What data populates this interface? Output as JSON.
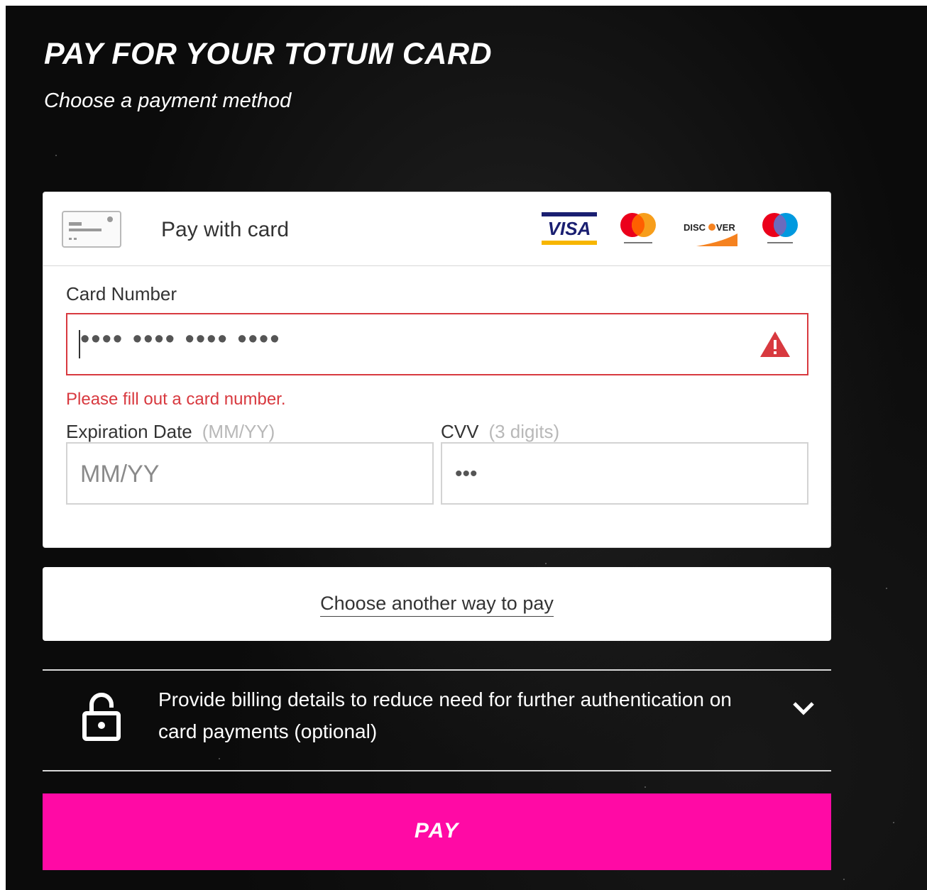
{
  "header": {
    "title": "PAY FOR YOUR TOTUM CARD",
    "subtitle": "Choose a payment method"
  },
  "card_panel": {
    "header_label": "Pay with card",
    "card_icon": "credit-card-icon",
    "brands": [
      {
        "name": "visa-logo",
        "text": "VISA"
      },
      {
        "name": "mastercard-logo",
        "text": "mastercard"
      },
      {
        "name": "discover-logo",
        "text": "DISCOVER"
      },
      {
        "name": "maestro-logo",
        "text": "maestro"
      }
    ],
    "card_number": {
      "label": "Card Number",
      "value": "•••• •••• •••• ••••",
      "error": "Please fill out a card number.",
      "error_icon": "warning-triangle-icon"
    },
    "expiration": {
      "label": "Expiration Date",
      "hint": "(MM/YY)",
      "placeholder": "MM/YY"
    },
    "cvv": {
      "label": "CVV",
      "hint": "(3 digits)",
      "placeholder": "•••"
    }
  },
  "alt_pay": {
    "label": "Choose another way to pay"
  },
  "billing": {
    "text": "Provide billing details to reduce need for further authentication on card payments (optional)",
    "icon": "unlock-icon",
    "toggle_icon": "chevron-down-icon"
  },
  "pay_button": {
    "label": "PAY"
  },
  "colors": {
    "accent": "#ff0aa5",
    "error": "#d8393f",
    "background": "#0b0b0b"
  }
}
